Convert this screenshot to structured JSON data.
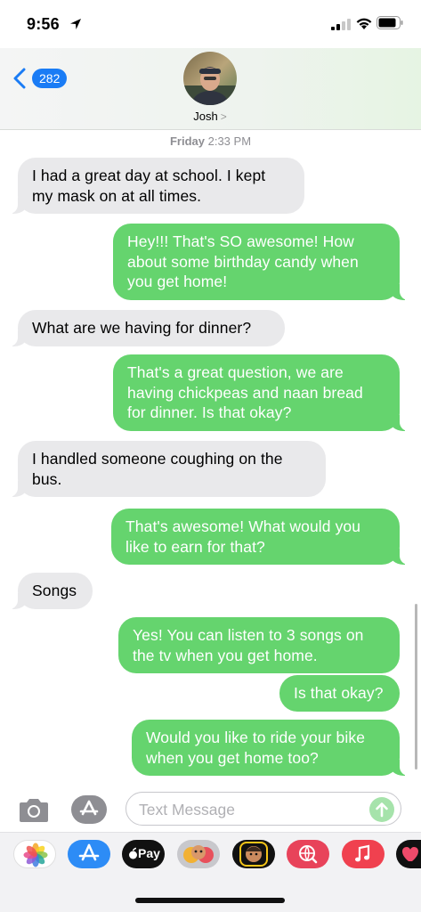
{
  "status_bar": {
    "time": "9:56"
  },
  "header": {
    "back_count": "282",
    "contact_name": "Josh",
    "contact_chevron": ">"
  },
  "conversation": {
    "timestamp_day": "Friday",
    "timestamp_time": "2:33 PM",
    "messages": [
      {
        "from": "them",
        "text": "I had a great day at school. I kept my mask on at all times."
      },
      {
        "from": "me",
        "text": "Hey!!! That's SO awesome! How about some birthday candy when you get home!"
      },
      {
        "from": "them",
        "text": "What are we having for dinner?"
      },
      {
        "from": "me",
        "text": "That's a great question, we are having chickpeas and naan bread for dinner. Is that okay?"
      },
      {
        "from": "them",
        "text": "I handled someone coughing on the bus."
      },
      {
        "from": "me",
        "text": "That's awesome! What would you like to earn for that?"
      },
      {
        "from": "them",
        "text": "Songs"
      },
      {
        "from": "me",
        "text": "Yes! You can listen to 3 songs on the tv when you get home."
      },
      {
        "from": "me",
        "text": "Is that okay?"
      },
      {
        "from": "me",
        "text": "Would you like to ride your bike when you get home too?"
      }
    ]
  },
  "input": {
    "placeholder": "Text Message"
  },
  "app_drawer": {
    "apps": [
      {
        "name": "photos-app-icon"
      },
      {
        "name": "app-store-app-icon"
      },
      {
        "name": "apple-pay-app-icon",
        "label": "Pay"
      },
      {
        "name": "memoji-stickers-app-icon"
      },
      {
        "name": "animoji-app-icon"
      },
      {
        "name": "web-image-search-app-icon"
      },
      {
        "name": "music-app-icon"
      },
      {
        "name": "digital-touch-app-icon"
      }
    ]
  },
  "colors": {
    "outgoing_bubble": "#65d46e",
    "incoming_bubble": "#e9e9eb",
    "accent_blue": "#1a7cf5"
  }
}
